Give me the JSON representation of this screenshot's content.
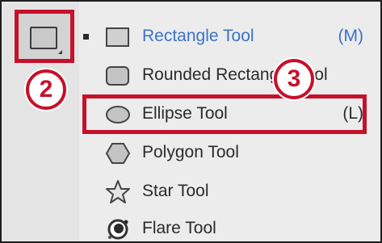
{
  "tool_button": {
    "icon": "rectangle-tool-icon"
  },
  "menu": {
    "items": [
      {
        "label": "Rectangle Tool",
        "shortcut": "(M)",
        "icon": "rectangle-icon",
        "selected": true
      },
      {
        "label": "Rounded Rectangle Tool",
        "shortcut": "",
        "icon": "rounded-rectangle-icon",
        "selected": false
      },
      {
        "label": "Ellipse Tool",
        "shortcut": "(L)",
        "icon": "ellipse-icon",
        "selected": false
      },
      {
        "label": "Polygon Tool",
        "shortcut": "",
        "icon": "polygon-icon",
        "selected": false
      },
      {
        "label": "Star Tool",
        "shortcut": "",
        "icon": "star-icon",
        "selected": false
      },
      {
        "label": "Flare Tool",
        "shortcut": "",
        "icon": "flare-icon",
        "selected": false
      }
    ]
  },
  "annotations": {
    "step_2": "2",
    "step_3": "3"
  },
  "colors": {
    "highlight": "#c7102a",
    "selected_text": "#3b72c9",
    "panel_bg": "#ececec",
    "toolbar_bg": "#e4e4e4"
  }
}
